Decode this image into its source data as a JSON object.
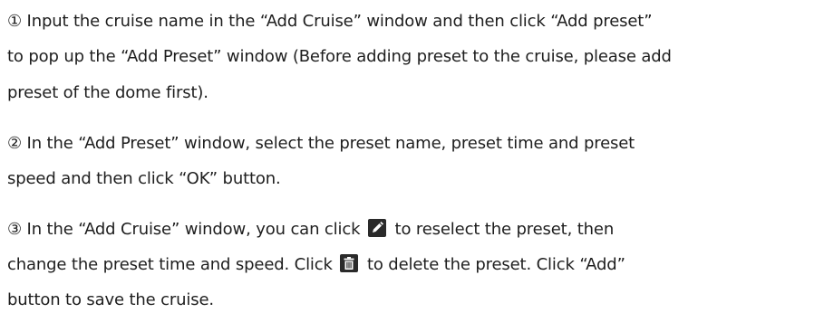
{
  "steps": [
    {
      "lines": [
        "① Input the cruise name in the “Add Cruise” window and then click “Add preset”",
        "to pop up the “Add Preset” window (Before adding preset to the cruise, please add",
        "preset of the dome first)."
      ]
    },
    {
      "lines": [
        "② In the “Add Preset” window, select the preset name, preset time and preset",
        "speed and then click “OK” button."
      ]
    },
    {
      "line1_before_icon": "③ In the “Add Cruise” window, you can click",
      "line1_after_icon": "to reselect the preset, then",
      "line2_before_icon": "change the preset time and speed. Click",
      "line2_after_icon": "to delete the preset. Click “Add”",
      "line3": "button to save the cruise.",
      "edit_icon": "pencil-edit-icon",
      "delete_icon": "trash-delete-icon"
    }
  ]
}
